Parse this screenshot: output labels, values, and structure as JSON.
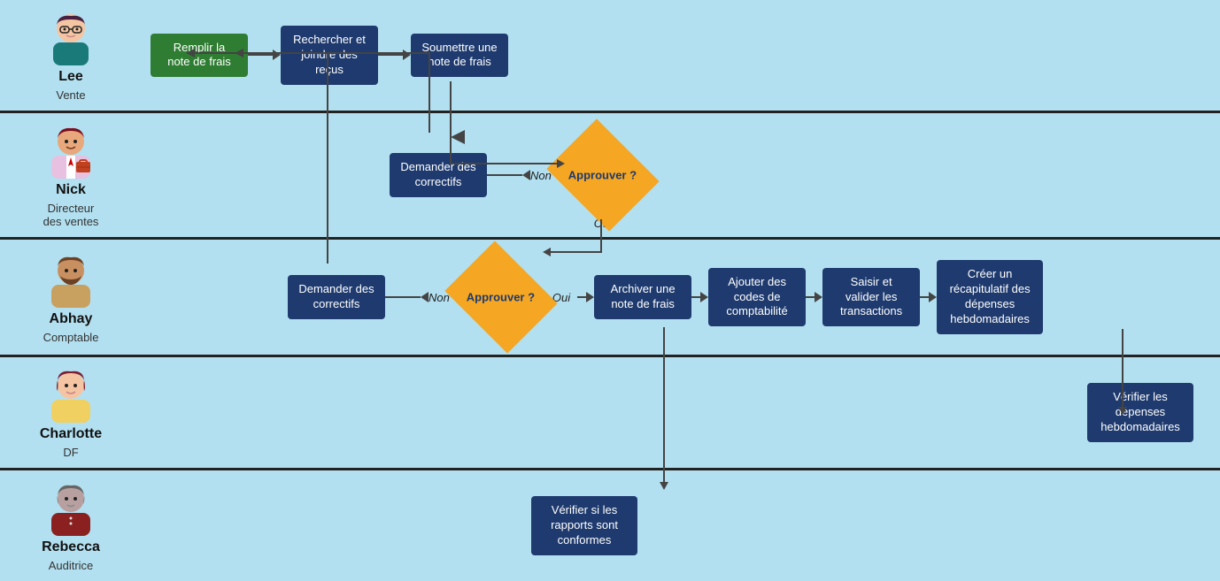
{
  "actors": {
    "lee": {
      "name": "Lee",
      "role": "Vente"
    },
    "nick": {
      "name": "Nick",
      "role": "Directeur\ndes ventes"
    },
    "abhay": {
      "name": "Abhay",
      "role": "Comptable"
    },
    "charlotte": {
      "name": "Charlotte",
      "role": "DF"
    },
    "rebecca": {
      "name": "Rebecca",
      "role": "Auditrice"
    }
  },
  "boxes": {
    "lee_box1": "Remplir la note de frais",
    "lee_box2": "Rechercher et joindre des reçus",
    "lee_box3": "Soumettre une note de frais",
    "nick_non": "Non",
    "nick_oui": "Oui",
    "nick_diamond": "Approuver ?",
    "nick_correctifs": "Demander des correctifs",
    "abhay_non": "Non",
    "abhay_oui": "Oui",
    "abhay_diamond": "Approuver ?",
    "abhay_correctifs": "Demander des correctifs",
    "abhay_archiver": "Archiver une note de frais",
    "abhay_codes": "Ajouter des codes de comptabilité",
    "abhay_saisir": "Saisir et valider les transactions",
    "abhay_recap": "Créer un récapitulatif des dépenses hebdomadaires",
    "charlotte_verifier": "Vérifier les dépenses hebdomadaires",
    "rebecca_verifier": "Vérifier si les rapports sont conformes"
  }
}
